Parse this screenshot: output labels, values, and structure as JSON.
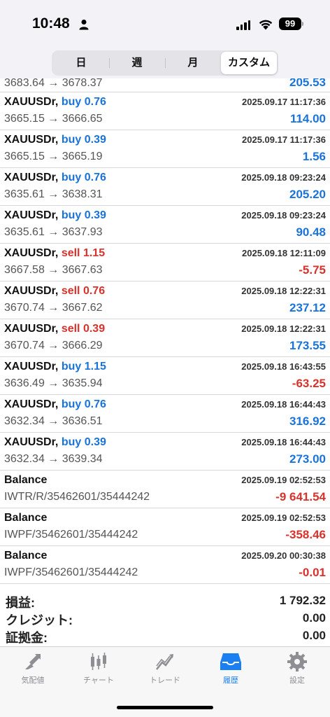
{
  "status": {
    "time": "10:48",
    "battery": "99"
  },
  "tabs_period": [
    "日",
    "週",
    "月",
    "カスタム"
  ],
  "partial_row": {
    "prices": "3683.64 → 3678.37",
    "profit": "205.53"
  },
  "deals": [
    {
      "symbol": "XAUUSDr,",
      "type": "buy",
      "volume": "0.76",
      "prices": "3665.15 → 3666.65",
      "date": "2025.09.17 11:17:36",
      "profit": "114.00",
      "sign": "pos"
    },
    {
      "symbol": "XAUUSDr,",
      "type": "buy",
      "volume": "0.39",
      "prices": "3665.15 → 3665.19",
      "date": "2025.09.17 11:17:36",
      "profit": "1.56",
      "sign": "pos"
    },
    {
      "symbol": "XAUUSDr,",
      "type": "buy",
      "volume": "0.76",
      "prices": "3635.61 → 3638.31",
      "date": "2025.09.18 09:23:24",
      "profit": "205.20",
      "sign": "pos"
    },
    {
      "symbol": "XAUUSDr,",
      "type": "buy",
      "volume": "0.39",
      "prices": "3635.61 → 3637.93",
      "date": "2025.09.18 09:23:24",
      "profit": "90.48",
      "sign": "pos"
    },
    {
      "symbol": "XAUUSDr,",
      "type": "sell",
      "volume": "1.15",
      "prices": "3667.58 → 3667.63",
      "date": "2025.09.18 12:11:09",
      "profit": "-5.75",
      "sign": "neg"
    },
    {
      "symbol": "XAUUSDr,",
      "type": "sell",
      "volume": "0.76",
      "prices": "3670.74 → 3667.62",
      "date": "2025.09.18 12:22:31",
      "profit": "237.12",
      "sign": "pos"
    },
    {
      "symbol": "XAUUSDr,",
      "type": "sell",
      "volume": "0.39",
      "prices": "3670.74 → 3666.29",
      "date": "2025.09.18 12:22:31",
      "profit": "173.55",
      "sign": "pos"
    },
    {
      "symbol": "XAUUSDr,",
      "type": "buy",
      "volume": "1.15",
      "prices": "3636.49 → 3635.94",
      "date": "2025.09.18 16:43:55",
      "profit": "-63.25",
      "sign": "neg"
    },
    {
      "symbol": "XAUUSDr,",
      "type": "buy",
      "volume": "0.76",
      "prices": "3632.34 → 3636.51",
      "date": "2025.09.18 16:44:43",
      "profit": "316.92",
      "sign": "pos"
    },
    {
      "symbol": "XAUUSDr,",
      "type": "buy",
      "volume": "0.39",
      "prices": "3632.34 → 3639.34",
      "date": "2025.09.18 16:44:43",
      "profit": "273.00",
      "sign": "pos"
    },
    {
      "symbol": "Balance",
      "type": "",
      "volume": "",
      "prices": "IWTR/R/35462601/35444242",
      "date": "2025.09.19 02:52:53",
      "profit": "-9 641.54",
      "sign": "neg"
    },
    {
      "symbol": "Balance",
      "type": "",
      "volume": "",
      "prices": "IWPF/35462601/35444242",
      "date": "2025.09.19 02:52:53",
      "profit": "-358.46",
      "sign": "neg"
    },
    {
      "symbol": "Balance",
      "type": "",
      "volume": "",
      "prices": "IWPF/35462601/35444242",
      "date": "2025.09.20 00:30:38",
      "profit": "-0.01",
      "sign": "neg"
    }
  ],
  "summary": [
    {
      "label": "損益:",
      "value": "1 792.32"
    },
    {
      "label": "クレジット:",
      "value": "0.00"
    },
    {
      "label": "証拠金:",
      "value": "0.00"
    }
  ],
  "bottom_tabs": [
    {
      "label": "気配値",
      "icon": "quotes-icon"
    },
    {
      "label": "チャート",
      "icon": "chart-icon"
    },
    {
      "label": "トレード",
      "icon": "trade-icon"
    },
    {
      "label": "履歴",
      "icon": "history-icon"
    },
    {
      "label": "設定",
      "icon": "settings-icon"
    }
  ],
  "colors": {
    "buy": "#1a73d9",
    "sell": "#d9312b",
    "active_tab": "#1a7ff0",
    "inactive_tab": "#8e8e93"
  }
}
